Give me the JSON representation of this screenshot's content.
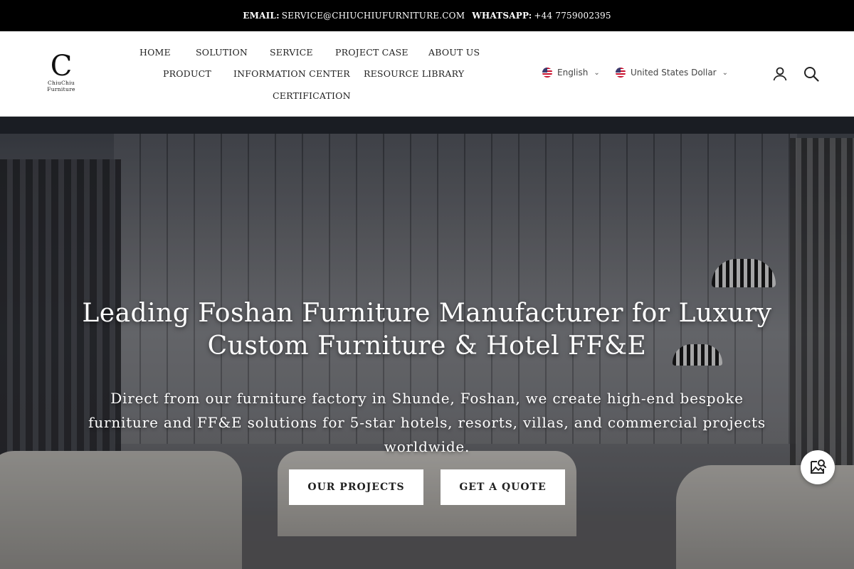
{
  "topbar": {
    "email_label": "EMAIL:",
    "email_value": "SERVICE@CHIUCHIUFURNITURE.COM",
    "whatsapp_label": "WHATSAPP:",
    "whatsapp_value": "+44 7759002395"
  },
  "logo": {
    "line1": "ChiuChiu",
    "line2": "Furniture"
  },
  "nav": {
    "items": [
      {
        "label": "HOME"
      },
      {
        "label": "SOLUTION"
      },
      {
        "label": "SERVICE"
      },
      {
        "label": "PROJECT CASE"
      },
      {
        "label": "ABOUT US"
      },
      {
        "label": "PRODUCT"
      },
      {
        "label": "INFORMATION CENTER"
      },
      {
        "label": "RESOURCE LIBRARY"
      },
      {
        "label": "CERTIFICATION"
      }
    ]
  },
  "language": {
    "selected": "English"
  },
  "currency": {
    "selected": "United States Dollar"
  },
  "icons": {
    "account": "user-icon",
    "search": "search-icon",
    "image_search": "image-search-icon"
  },
  "hero": {
    "title": "Leading Foshan Furniture Manufacturer for Luxury Custom Furniture & Hotel FF&E",
    "subtitle": "Direct from our furniture factory in Shunde, Foshan, we create high-end bespoke furniture and FF&E solutions for 5-star hotels, resorts, villas, and commercial projects worldwide.",
    "primary_button": "OUR PROJECTS",
    "secondary_button": "GET A QUOTE"
  }
}
